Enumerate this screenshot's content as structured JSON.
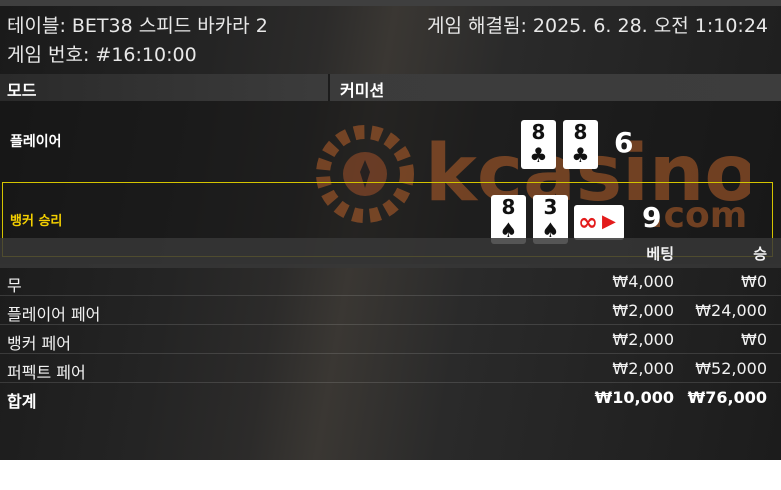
{
  "header": {
    "table": "테이블: BET38 스피드 바카라 2",
    "round": "게임 번호: #16:10:00",
    "resolved": "게임 해결됨: 2025. 6. 28. 오전 1:10:24"
  },
  "mode": {
    "label": "모드",
    "value": "커미션"
  },
  "result": {
    "player": {
      "label": "플레이어",
      "score": "6",
      "cards": [
        {
          "rank": "8",
          "suit": "♣"
        },
        {
          "rank": "8",
          "suit": "♣"
        }
      ]
    },
    "banker": {
      "label": "뱅커 승리",
      "score": "9",
      "cards": [
        {
          "rank": "8",
          "suit": "♠"
        },
        {
          "rank": "3",
          "suit": "♠"
        }
      ],
      "third_card": {
        "symbol": "∞",
        "arrow": "▶"
      }
    }
  },
  "watermark": {
    "main": "kcasino",
    "sub": ".com"
  },
  "bets": {
    "headers": {
      "bet": "베팅",
      "win": "승"
    },
    "rows": [
      {
        "name": "무",
        "bet": "₩4,000",
        "win": "₩0"
      },
      {
        "name": "플레이어 페어",
        "bet": "₩2,000",
        "win": "₩24,000"
      },
      {
        "name": "뱅커 페어",
        "bet": "₩2,000",
        "win": "₩0"
      },
      {
        "name": "퍼펙트 페어",
        "bet": "₩2,000",
        "win": "₩52,000"
      }
    ],
    "total": {
      "name": "합계",
      "bet": "₩10,000",
      "win": "₩76,000"
    }
  },
  "colors": {
    "banker_highlight": "#f4d000",
    "watermark": "#c0652a",
    "red_suit": "#e31b1b"
  }
}
